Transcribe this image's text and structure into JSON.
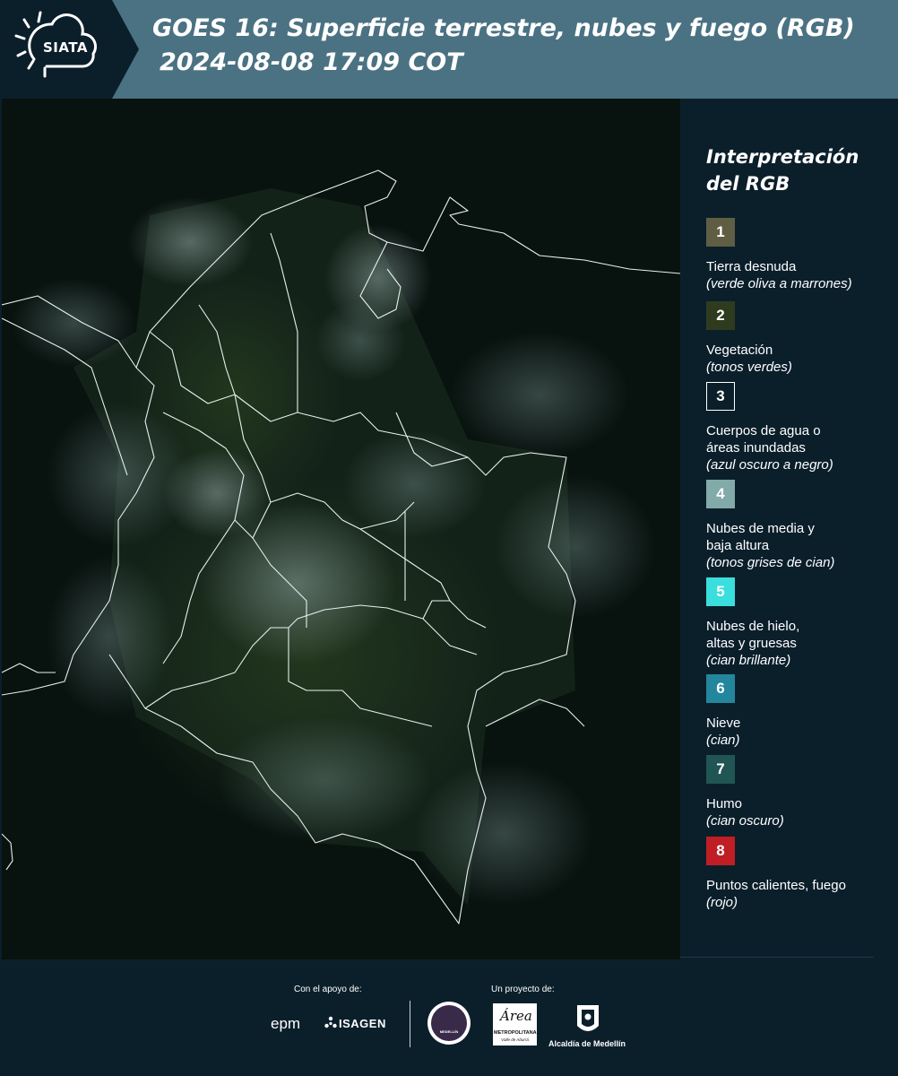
{
  "header": {
    "logo": "SIATA",
    "title": "GOES 16: Superficie terrestre, nubes y fuego (RGB)",
    "datetime": "2024-08-08 17:09 COT"
  },
  "legend": {
    "title_line1": "Interpretación",
    "title_line2": "del RGB",
    "items": [
      {
        "number": "1",
        "label": "Tierra desnuda",
        "desc": "(verde oliva a marrones)",
        "color": "#5f5e44"
      },
      {
        "number": "2",
        "label": "Vegetación",
        "desc": "(tonos verdes)",
        "color": "#2f3b1f"
      },
      {
        "number": "3",
        "label_line1": "Cuerpos de agua o",
        "label_line2": "áreas inundadas",
        "desc": "(azul oscuro a negro)",
        "color": "#0b1f2b"
      },
      {
        "number": "4",
        "label_line1": "Nubes de media y",
        "label_line2": "baja altura",
        "desc": "(tonos grises de cian)",
        "color": "#82aaa9"
      },
      {
        "number": "5",
        "label_line1": "Nubes de hielo,",
        "label_line2": "altas y gruesas",
        "desc": "(cian brillante)",
        "color": "#39dedd"
      },
      {
        "number": "6",
        "label": "Nieve",
        "desc": "(cian)",
        "color": "#22869c"
      },
      {
        "number": "7",
        "label": "Humo",
        "desc": "(cian oscuro)",
        "color": "#205554"
      },
      {
        "number": "8",
        "label": "Puntos calientes, fuego",
        "desc": "(rojo)",
        "color": "#bf1e24"
      }
    ]
  },
  "footer": {
    "support_caption": "Con el apoyo de:",
    "project_caption": "Un proyecto de:",
    "partners": {
      "epm": "epm",
      "isagen": "ISAGEN",
      "area_script": "Área",
      "area_name": "METROPOLITANA",
      "area_sub": "Valle de Aburrá",
      "alcaldia": "Alcaldía de Medellín",
      "seal": "MEDELLÍN"
    }
  }
}
